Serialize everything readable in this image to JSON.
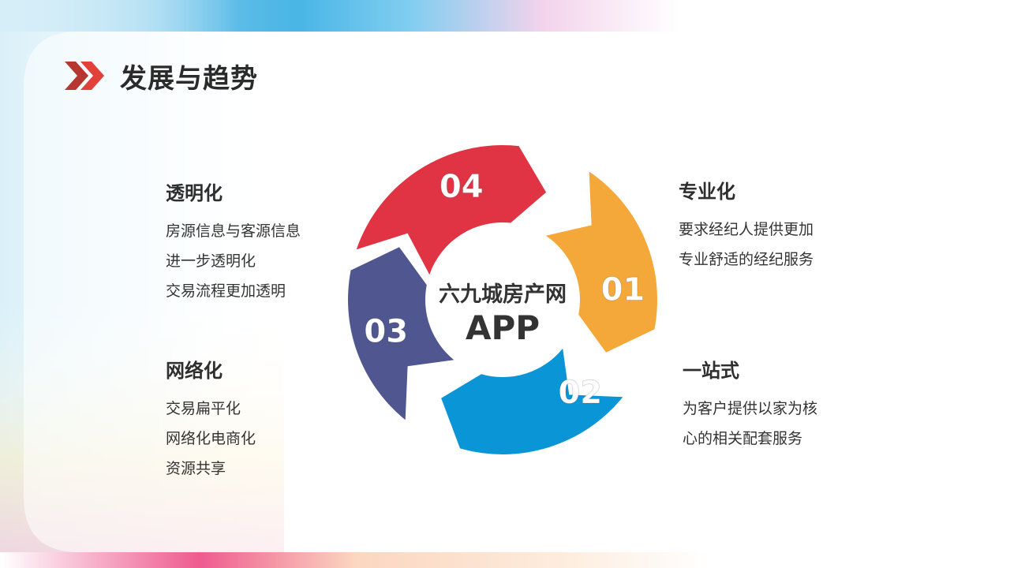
{
  "page": {
    "title": "发展与趋势"
  },
  "colors": {
    "accent": "#d7302b",
    "seg01": "#f4a83a",
    "seg02": "#0a95d7",
    "seg03": "#4f5690",
    "seg04": "#e03444"
  },
  "diagram": {
    "center": {
      "line1": "六九城房产网",
      "line2": "APP"
    },
    "segments": [
      {
        "number": "01",
        "color": "#f4a83a"
      },
      {
        "number": "02",
        "color": "#0a95d7"
      },
      {
        "number": "03",
        "color": "#4f5690"
      },
      {
        "number": "04",
        "color": "#e03444"
      }
    ]
  },
  "items": {
    "transparent": {
      "title": "透明化",
      "lines": [
        "房源信息与客源信息",
        "进一步透明化",
        "交易流程更加透明"
      ]
    },
    "network": {
      "title": "网络化",
      "lines": [
        "交易扁平化",
        "网络化电商化",
        "资源共享"
      ]
    },
    "professional": {
      "title": "专业化",
      "lines": [
        "要求经纪人提供更加",
        "专业舒适的经纪服务"
      ]
    },
    "onestop": {
      "title": "一站式",
      "lines": [
        "为客户提供以家为核",
        "心的相关配套服务"
      ]
    }
  }
}
